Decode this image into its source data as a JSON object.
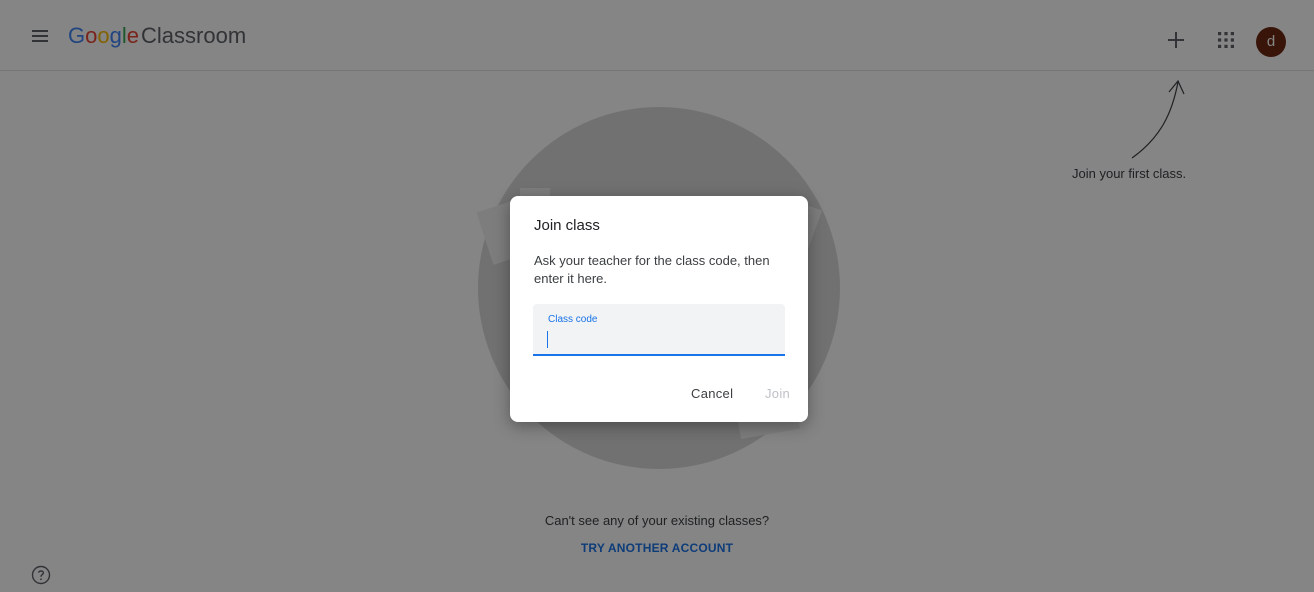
{
  "header": {
    "logo_letters": [
      "G",
      "o",
      "o",
      "g",
      "l",
      "e"
    ],
    "product_name": "Classroom",
    "avatar_initial": "d",
    "icons": {
      "menu": "hamburger-menu-icon",
      "add": "plus-icon",
      "apps": "apps-grid-icon"
    }
  },
  "main": {
    "hint_text": "Join your first class.",
    "cant_see_text": "Can't see any of your existing classes?",
    "try_another_label": "TRY ANOTHER ACCOUNT"
  },
  "dialog": {
    "title": "Join class",
    "description": "Ask your teacher for the class code, then enter it here.",
    "field_label": "Class code",
    "field_value": "",
    "cancel_label": "Cancel",
    "join_label": "Join"
  },
  "colors": {
    "accent": "#1a73e8",
    "avatar_bg": "#6d2a12",
    "scrim": "rgba(0,0,0,0.48)"
  }
}
